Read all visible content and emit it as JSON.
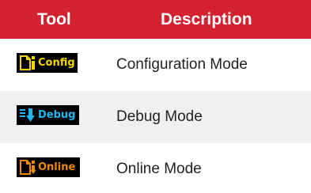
{
  "header": {
    "tool_label": "Tool",
    "description_label": "Description"
  },
  "rows": [
    {
      "badge_label": "Config",
      "badge_icon": "config-mode-icon",
      "badge_color": "#f3d600",
      "description": "Configuration Mode"
    },
    {
      "badge_label": "Debug",
      "badge_icon": "debug-mode-icon",
      "badge_color": "#1fb7f3",
      "description": "Debug Mode"
    },
    {
      "badge_label": "Online",
      "badge_icon": "online-mode-icon",
      "badge_color": "#f08a00",
      "description": "Online Mode"
    }
  ],
  "colors": {
    "header_bg": "#d3212f",
    "header_text": "#ffffff",
    "alt_row_bg": "#f0f0f0"
  }
}
